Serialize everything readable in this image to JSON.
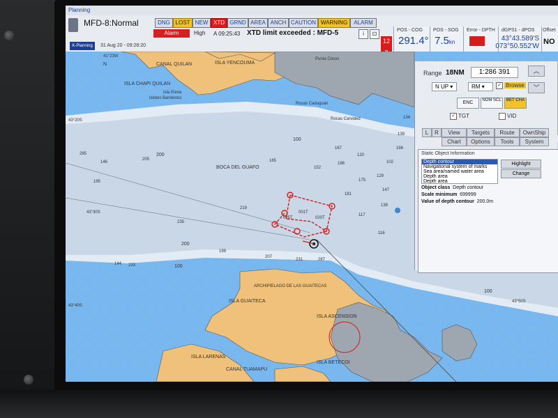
{
  "window": {
    "title": "Planning",
    "mode": "MFD-8:Normal",
    "planning_badge": "K-Planning",
    "datetime": "31 Aug 20 - 09:28:20"
  },
  "alarms": {
    "buttons": [
      {
        "label": "DNG",
        "state": "normal"
      },
      {
        "label": "LOST",
        "state": "warning"
      },
      {
        "label": "NEW",
        "state": "normal"
      },
      {
        "label": "XTD",
        "state": "alarm"
      },
      {
        "label": "GRND",
        "state": "normal"
      },
      {
        "label": "AREA",
        "state": "normal"
      },
      {
        "label": "ANCH",
        "state": "normal"
      },
      {
        "label": "CAUTION",
        "state": "normal"
      },
      {
        "label": "WARNING",
        "state": "warning"
      },
      {
        "label": "ALARM",
        "state": "normal"
      }
    ],
    "alarm_indicator": "Alarm",
    "priority": "High",
    "message_time": "A 09:25:43",
    "message": "XTD limit exceeded : MFD-5",
    "count": "12",
    "scroll_icon": "double-chevron-down-icon"
  },
  "nav": {
    "cog_label": "POS - COG",
    "cog_value": "291.4°",
    "sog_label": "POS - SOG",
    "sog_value": "7.5",
    "sog_unit": "kn",
    "dpth_label": "Error - DPTH",
    "pos_label": "dGPS1 - dPOS",
    "lat": "43°43.589'S",
    "lon": "073°50.552'W",
    "offset_label": "Offset",
    "offset_value": "NO"
  },
  "panel": {
    "range_label": "Range",
    "range_value": "18NM",
    "scale": "1:286 391",
    "zoom_in_icon": "chevron-up-icon",
    "zoom_out_icon": "chevron-down-icon",
    "orientation": "N UP",
    "motion": "RM",
    "browse_label": "Browse",
    "browse_checked": "✓",
    "enc_label": "ENC",
    "nom_scl_label": "NOM SCL",
    "bet_cha_label": "BET CHA",
    "tgt_label": "TGT",
    "vid_label": "VID",
    "tgt_checked": "✓",
    "tabs_row1": [
      "L",
      "R",
      "View",
      "Targets",
      "Route",
      "OwnShip"
    ],
    "tabs_row2": [
      "",
      "",
      "Chart",
      "Options",
      "Tools",
      "System"
    ],
    "soi_title": "Static Object Information",
    "soi_list": [
      "Depth contour",
      "Navigational system of marks",
      "Sea area/named water area",
      "Depth area",
      "Depth area"
    ],
    "highlight_label": "Highlight",
    "change_label": "Change",
    "object_class_label": "Object class",
    "object_class_value": "Depth contour",
    "scale_min_label": "Scale minimum",
    "scale_min_value": "699999",
    "depth_value_label": "Value of depth contour",
    "depth_value_value": "200.0m"
  },
  "map": {
    "place_names": [
      "CANAL QUILAN",
      "ISLA YENCOUMA",
      "ISLA CHAPI QUILAN",
      "Islotes Barrientos",
      "Rocas Caduguari",
      "Rocas Carvided",
      "BOCA DEL GUAFO",
      "ISLA GUAITECA",
      "ISLA ASCENSION",
      "ARCHIPIELAGO DE LAS GUAITECAS",
      "ISLA LARENAS",
      "ISLA BETECOI",
      "CANAL TUAMAPU",
      "Isla Elena",
      "Punta Cocos"
    ],
    "latitudes": [
      "43°20S",
      "43°30S",
      "43°40S",
      "43°50S"
    ],
    "contour_labels": [
      "100",
      "200",
      "100",
      "200",
      "100"
    ],
    "soundings": [
      "285",
      "205",
      "146",
      "195",
      "235",
      "219",
      "165",
      "152",
      "186",
      "175",
      "181",
      "116",
      "144",
      "199",
      "233",
      "207",
      "231",
      "287",
      "166",
      "129",
      "117",
      "138",
      "139",
      "134",
      "120",
      "147",
      "167",
      "102"
    ],
    "waypoints": [
      "025T",
      "020T",
      "001T"
    ],
    "ui_marks": [
      "N",
      "41°23W"
    ]
  }
}
